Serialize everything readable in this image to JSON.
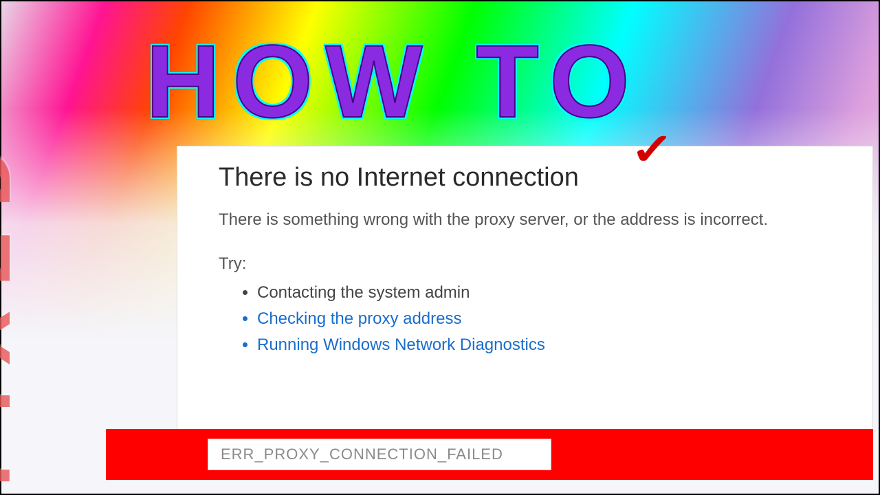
{
  "thumbnail": {
    "howto": "HOW TO",
    "fixed": "FIXED"
  },
  "error": {
    "title": "There is no Internet connection",
    "description": "There is something wrong with the proxy server, or the address is incorrect.",
    "try_label": "Try:",
    "suggestions": [
      "Contacting the system admin",
      "Checking the proxy address",
      "Running Windows Network Diagnostics"
    ],
    "error_code": "ERR_PROXY_CONNECTION_FAILED"
  },
  "icons": {
    "checkmark": "✓"
  }
}
